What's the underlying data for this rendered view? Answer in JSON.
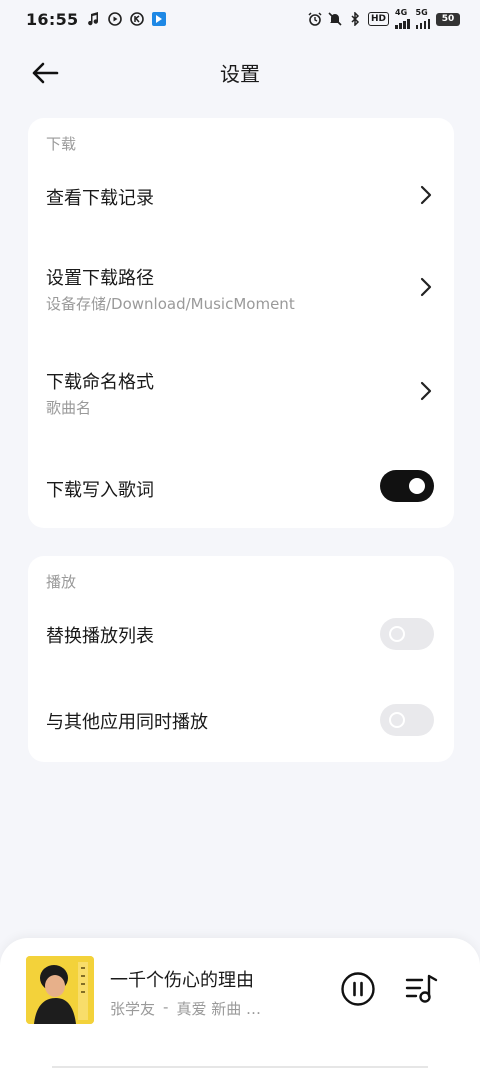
{
  "status_bar": {
    "time": "16:55",
    "hd_label": "HD",
    "net1_label": "4G",
    "net2_label": "5G",
    "battery": "50"
  },
  "header": {
    "title": "设置"
  },
  "download_section": {
    "title": "下载",
    "view_history": {
      "label": "查看下载记录"
    },
    "download_path": {
      "label": "设置下载路径",
      "value": "设备存储/Download/MusicMoment"
    },
    "naming_format": {
      "label": "下载命名格式",
      "value": "歌曲名"
    },
    "write_lyrics": {
      "label": "下载写入歌词",
      "enabled": true
    }
  },
  "playback_section": {
    "title": "播放",
    "replace_playlist": {
      "label": "替换播放列表",
      "enabled": false
    },
    "mix_with_others": {
      "label": "与其他应用同时播放",
      "enabled": false
    }
  },
  "player": {
    "song_title": "一千个伤心的理由",
    "artist": "张学友",
    "separator": "-",
    "album": "真爱 新曲 …",
    "album_art_colors": {
      "primary": "#f1c92d"
    }
  },
  "colors": {
    "background": "#f5f6fa",
    "card": "#ffffff",
    "toggle_on": "#111111",
    "toggle_off": "#e9e9ec",
    "secondary_text": "#9a9a9a"
  }
}
